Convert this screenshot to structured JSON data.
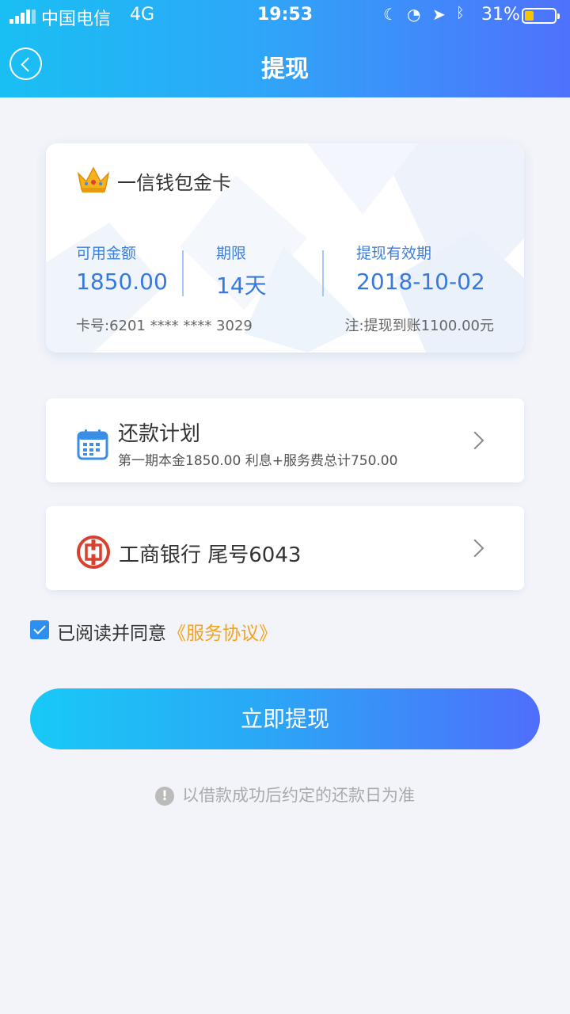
{
  "status_bar": {
    "carrier": "中国电信",
    "network": "4G",
    "time": "19:53",
    "battery_percent_text": "31%",
    "battery_level": 0.31,
    "icons": [
      "moon-icon",
      "rotation-lock-icon",
      "location-icon",
      "bluetooth-icon"
    ]
  },
  "header": {
    "title": "提现",
    "back_icon": "back-arrow-icon"
  },
  "card": {
    "name": "一信钱包金卡",
    "icon": "crown-icon",
    "available_label": "可用金额",
    "available_value": "1850.00",
    "term_label": "期限",
    "term_value": "14天",
    "validity_label": "提现有效期",
    "validity_value": "2018-10-02",
    "card_number": "卡号:6201 **** **** 3029",
    "note": "注:提现到账1100.00元"
  },
  "repayment": {
    "title": "还款计划",
    "subtitle": "第一期本金1850.00 利息+服务费总计750.00",
    "icon": "calendar-icon"
  },
  "bank": {
    "label": "工商银行 尾号6043",
    "icon": "icbc-logo-icon"
  },
  "agreement": {
    "checked": true,
    "text": "已阅读并同意",
    "link": "《服务协议》"
  },
  "submit_button": "立即提现",
  "tip": {
    "icon_glyph": "!",
    "text": "以借款成功后约定的还款日为准"
  },
  "colors": {
    "header_gradient_start": "#19bff3",
    "header_gradient_end": "#4f71fc",
    "accent_blue": "#3779de",
    "link_orange": "#f5a21b",
    "battery_yellow": "#f7c500"
  }
}
